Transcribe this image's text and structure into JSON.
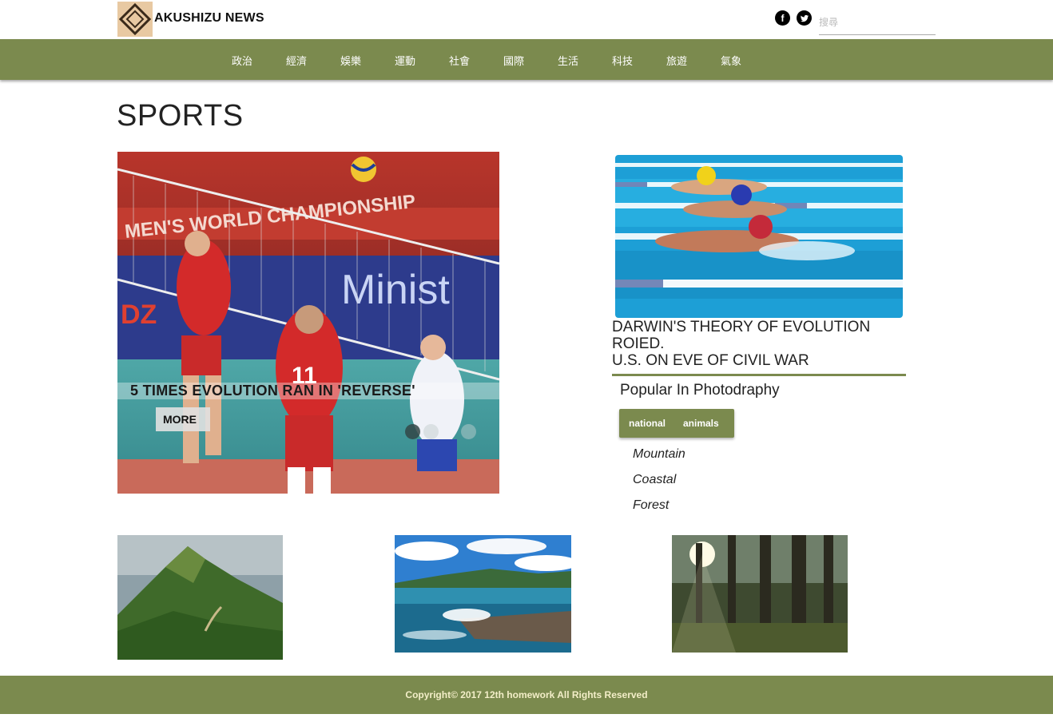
{
  "header": {
    "brand": "AKUSHIZU NEWS",
    "search_placeholder": "搜尋",
    "social": {
      "facebook": "f",
      "twitter": "t"
    }
  },
  "nav": {
    "items": [
      "政治",
      "經濟",
      "娛樂",
      "運動",
      "社會",
      "國際",
      "生活",
      "科技",
      "旅遊",
      "氣象"
    ]
  },
  "page": {
    "title": "SPORTS"
  },
  "hero": {
    "caption": "5 TIMES EVOLUTION RAN IN 'REVERSE'",
    "more_label": "MORE",
    "slide_count": 3,
    "active_slide": 1
  },
  "side": {
    "headline_lines": [
      "DARWIN'S THEORY OF EVOLUTION",
      "ROIED.",
      "U.S. ON EVE OF CIVIL WAR"
    ],
    "popular_title": "Popular In Photodraphy",
    "tabs": [
      "national",
      "animals"
    ],
    "categories": [
      "Mountain",
      "Coastal",
      "Forest"
    ]
  },
  "footer": {
    "copyright": "Copyright© 2017 12th homework All Rights Reserved"
  },
  "colors": {
    "accent": "#7b8a4e",
    "footer_text": "#f3eec8"
  }
}
